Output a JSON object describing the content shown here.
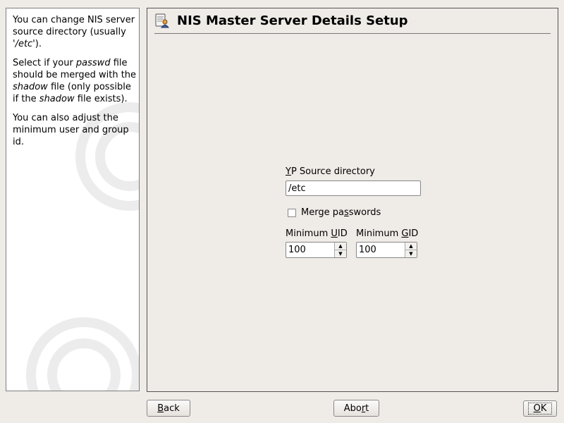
{
  "help": {
    "para1_a": "You can change NIS server source directory (usually ",
    "para1_path": "'/etc'",
    "para1_b": ").",
    "para2_a": "Select if your ",
    "para2_passwd": "passwd",
    "para2_b": " file should be merged with the ",
    "para2_shadow1": "shadow",
    "para2_c": " file (only possible if the ",
    "para2_shadow2": "shadow",
    "para2_d": " file exists).",
    "para3": "You can also adjust the minimum user and group id."
  },
  "header": {
    "title": "NIS Master Server Details Setup",
    "icon": "nis-server-icon"
  },
  "form": {
    "yp_label_mnemonic": "Y",
    "yp_label_rest": "P Source directory",
    "yp_value": "/etc",
    "merge_label_pre": "Merge pa",
    "merge_label_mnemonic": "s",
    "merge_label_post": "swords",
    "merge_checked": false,
    "min_uid_label_pre": "Minimum ",
    "min_uid_label_mnemonic": "U",
    "min_uid_label_post": "ID",
    "min_uid_value": "100",
    "min_gid_label_pre": "Minimum ",
    "min_gid_label_mnemonic": "G",
    "min_gid_label_post": "ID",
    "min_gid_value": "100"
  },
  "buttons": {
    "back_mnemonic": "B",
    "back_rest": "ack",
    "abort_pre": "Abo",
    "abort_mnemonic": "r",
    "abort_post": "t",
    "ok_mnemonic": "O",
    "ok_rest": "K"
  }
}
